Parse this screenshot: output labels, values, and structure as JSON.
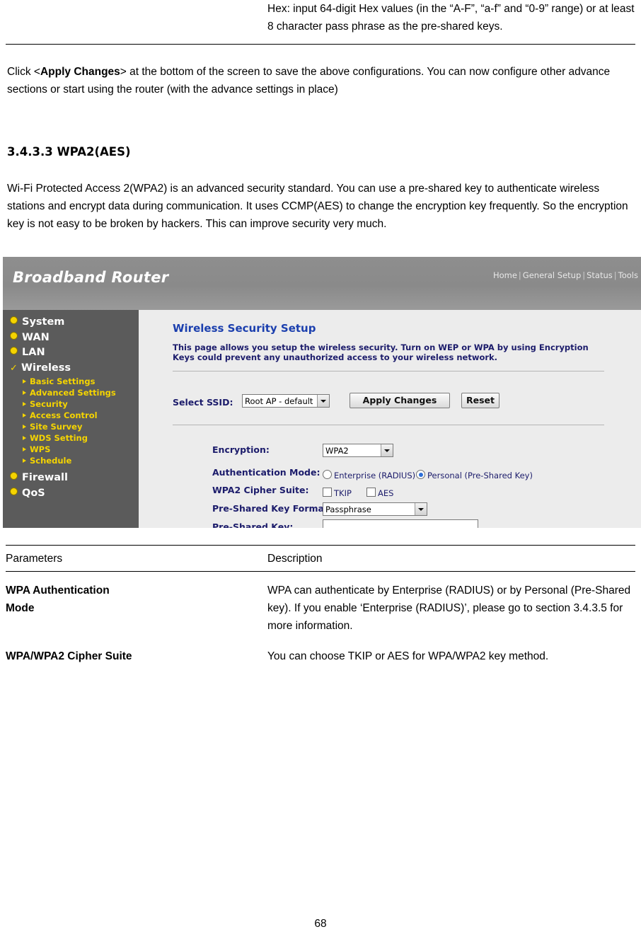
{
  "top_continued": {
    "hex_note": "Hex: input 64-digit Hex values (in the “A-F”, “a-f” and “0-9” range) or at least 8 character pass phrase as the pre-shared keys."
  },
  "apply_paragraph": {
    "before": "Click <",
    "bold": "Apply Changes",
    "after": "> at the bottom of the screen to save the above configurations. You can now configure other advance sections or start using the router (with the advance settings in place)"
  },
  "section": {
    "heading": "3.4.3.3 WPA2(AES)",
    "body": "Wi-Fi Protected Access 2(WPA2) is an advanced security standard. You can use a pre-shared key to authenticate wireless stations and encrypt data during communication. It uses CCMP(AES) to change the encryption key frequently. So the encryption key is not easy to be broken by hackers. This can improve security very much."
  },
  "router_ui": {
    "title": "Broadband Router",
    "nav": [
      "Home",
      "General Setup",
      "Status",
      "Tools"
    ],
    "nav_separator": "|",
    "sidebar": [
      {
        "label": "System",
        "type": "main",
        "icon": "bullet-icon"
      },
      {
        "label": "WAN",
        "type": "main",
        "icon": "bullet-icon"
      },
      {
        "label": "LAN",
        "type": "main",
        "icon": "bullet-icon"
      },
      {
        "label": "Wireless",
        "type": "main",
        "icon": "check-icon"
      },
      {
        "label": "Basic Settings",
        "type": "sub",
        "icon": "arrow-icon"
      },
      {
        "label": "Advanced Settings",
        "type": "sub",
        "icon": "arrow-icon"
      },
      {
        "label": "Security",
        "type": "sub",
        "icon": "arrow-icon"
      },
      {
        "label": "Access Control",
        "type": "sub",
        "icon": "arrow-icon"
      },
      {
        "label": "Site Survey",
        "type": "sub",
        "icon": "arrow-icon"
      },
      {
        "label": "WDS Setting",
        "type": "sub",
        "icon": "arrow-icon"
      },
      {
        "label": "WPS",
        "type": "sub",
        "icon": "arrow-icon"
      },
      {
        "label": "Schedule",
        "type": "sub",
        "icon": "arrow-icon"
      },
      {
        "label": "Firewall",
        "type": "main",
        "icon": "bullet-icon"
      },
      {
        "label": "QoS",
        "type": "main",
        "icon": "bullet-icon"
      }
    ],
    "panel": {
      "title": "Wireless Security Setup",
      "description": "This page allows you setup the wireless security. Turn on WEP or WPA by using Encryption Keys could prevent any unauthorized access to your wireless network.",
      "select_ssid_label": "Select SSID:",
      "select_ssid_value": "Root AP - default",
      "apply_button": "Apply Changes",
      "reset_button": "Reset",
      "encryption_label": "Encryption:",
      "encryption_value": "WPA2",
      "auth_mode_label": "Authentication Mode:",
      "auth_enterprise": "Enterprise (RADIUS)",
      "auth_personal": "Personal (Pre-Shared Key)",
      "auth_selected": "personal",
      "cipher_label": "WPA2 Cipher Suite:",
      "cipher_tkip": "TKIP",
      "cipher_aes": "AES",
      "psk_format_label": "Pre-Shared Key Format:",
      "psk_format_value": "Passphrase",
      "psk_label": "Pre-Shared Key:",
      "psk_value": ""
    }
  },
  "params_table": {
    "header_parameters": "Parameters",
    "header_description": "Description",
    "rows": [
      {
        "param_line1": "WPA Authentication",
        "param_line2": "Mode",
        "description": "WPA can authenticate by Enterprise (RADIUS) or by Personal (Pre-Shared key). If you enable ‘Enterprise (RADIUS)’, please go to section 3.4.3.5 for more information."
      },
      {
        "param_line1": "WPA/WPA2 Cipher Suite",
        "param_line2": "",
        "description": "You can choose TKIP or AES for WPA/WPA2 key method."
      }
    ]
  },
  "page_number": "68"
}
